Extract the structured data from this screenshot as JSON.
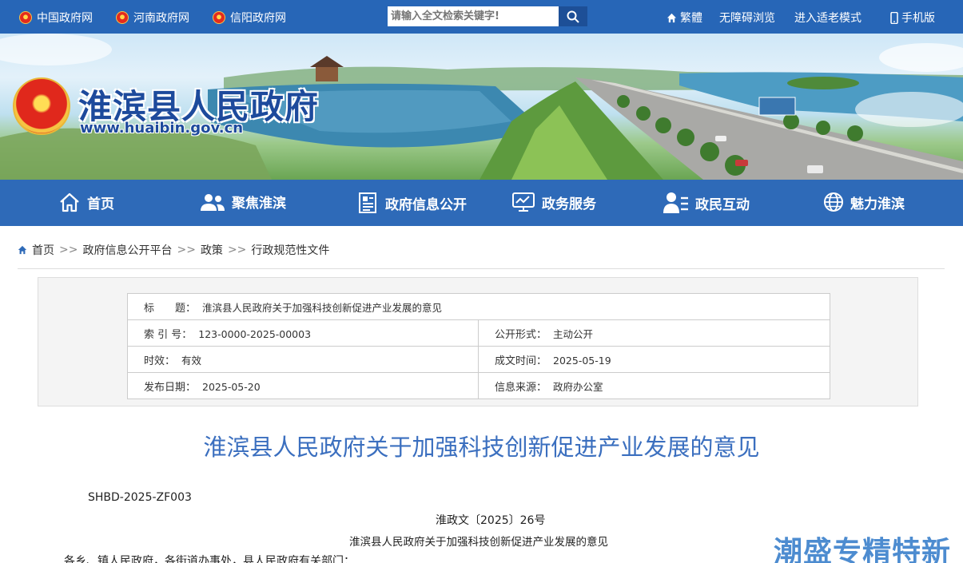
{
  "topbar": {
    "links": [
      "中国政府网",
      "河南政府网",
      "信阳政府网"
    ],
    "search_placeholder": "请输入全文检索关键字!",
    "right": {
      "traditional": "繁體",
      "accessible": "无障碍浏览",
      "elderly": "进入适老模式",
      "mobile": "手机版"
    }
  },
  "banner": {
    "title": "淮滨县人民政府",
    "url": "www.huaibin.gov.cn"
  },
  "nav": {
    "items": [
      {
        "label": "首页",
        "icon": "home-icon"
      },
      {
        "label": "聚焦淮滨",
        "icon": "people-icon"
      },
      {
        "label": "政府信息公开",
        "icon": "document-icon"
      },
      {
        "label": "政务服务",
        "icon": "monitor-icon"
      },
      {
        "label": "政民互动",
        "icon": "chat-user-icon"
      },
      {
        "label": "魅力淮滨",
        "icon": "globe-icon"
      }
    ]
  },
  "breadcrumb": {
    "items": [
      "首页",
      "政府信息公开平台",
      "政策",
      "行政规范性文件"
    ],
    "separator": ">>"
  },
  "info": {
    "title_label": "标　　题：",
    "title_value": "淮滨县人民政府关于加强科技创新促进产业发展的意见",
    "index_label": "索 引 号：",
    "index_value": "123-0000-2025-00003",
    "open_form_label": "公开形式：",
    "open_form_value": "主动公开",
    "validity_label": "时效：",
    "validity_value": "有效",
    "created_label": "成文时间：",
    "created_value": "2025-05-19",
    "published_label": "发布日期：",
    "published_value": "2025-05-20",
    "source_label": "信息来源：",
    "source_value": "政府办公室"
  },
  "article": {
    "title": "淮滨县人民政府关于加强科技创新促进产业发展的意见",
    "code": "SHBD-2025-ZF003",
    "doc_number": "淮政文〔2025〕26号",
    "subtitle": "淮滨县人民政府关于加强科技创新促进产业发展的意见",
    "addressee": "各乡、镇人民政府，各街道办事处，县人民政府有关部门："
  },
  "watermark": "潮盛专精特新",
  "colors": {
    "topbar": "#2766b7",
    "nav": "#2e6ab8",
    "title_blue": "#3b6fbf"
  }
}
